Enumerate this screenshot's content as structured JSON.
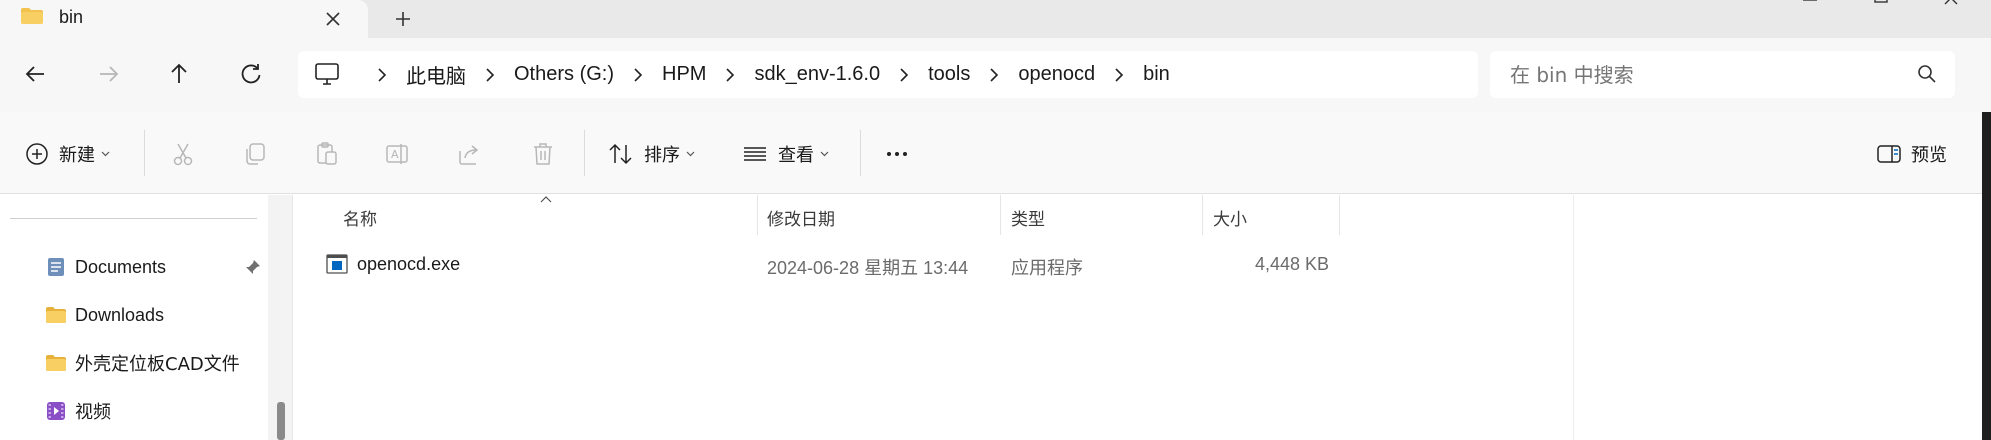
{
  "tab": {
    "title": "bin"
  },
  "breadcrumb": [
    "此电脑",
    "Others (G:)",
    "HPM",
    "sdk_env-1.6.0",
    "tools",
    "openocd",
    "bin"
  ],
  "search": {
    "placeholder": "在 bin 中搜索"
  },
  "commands": {
    "new_label": "新建",
    "sort_label": "排序",
    "view_label": "查看",
    "preview_label": "预览"
  },
  "sidebar": {
    "items": [
      {
        "label": "Documents",
        "icon": "documents-icon",
        "pinned": true
      },
      {
        "label": "Downloads",
        "icon": "folder-icon"
      },
      {
        "label": "外壳定位板CAD文件",
        "icon": "folder-icon"
      },
      {
        "label": "视频",
        "icon": "videos-icon"
      }
    ]
  },
  "columns": {
    "name": "名称",
    "modified": "修改日期",
    "type": "类型",
    "size": "大小"
  },
  "files": [
    {
      "name": "openocd.exe",
      "modified": "2024-06-28 星期五 13:44",
      "type": "应用程序",
      "size": "4,448 KB",
      "icon": "application-icon"
    }
  ],
  "colors": {
    "folder": "#f2c14e",
    "accent": "#0067c0",
    "disabled_icon": "#b7b7b7"
  }
}
